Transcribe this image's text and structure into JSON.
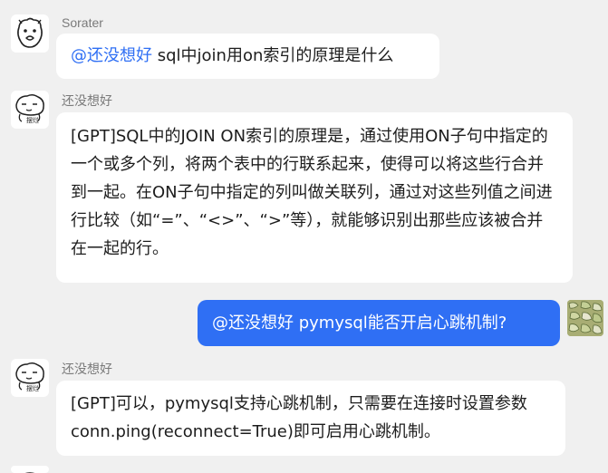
{
  "messages": [
    {
      "sender": "Sorater",
      "avatar_icon": "cartoon-face-icon",
      "mention": "@还没想好",
      "text": " sql中join用on索引的原理是什么"
    },
    {
      "sender": "还没想好",
      "avatar_icon": "cartoon-face-icon",
      "avatar_caption": "摆烂",
      "text": "[GPT]SQL中的JOIN ON索引的原理是，通过使用ON子句中指定的一个或多个列，将两个表中的行联系起来，使得可以将这些行合并到一起。在ON子句中指定的列叫做关联列，通过对这些列值之间进行比较（如“=”、“<>”、“>”等），就能够识别出那些应该被合并在一起的行。"
    },
    {
      "sender": "",
      "avatar_icon": "pattern-avatar-icon",
      "self": true,
      "text": "@还没想好 pymysql能否开启心跳机制?"
    },
    {
      "sender": "还没想好",
      "avatar_icon": "cartoon-face-icon",
      "avatar_caption": "摆烂",
      "text": "[GPT]可以，pymysql支持心跳机制，只需要在连接时设置参数conn.ping(reconnect=True)即可启用心跳机制。"
    }
  ],
  "colors": {
    "background": "#f0f0f0",
    "bubble": "#ffffff",
    "self_bubble": "#2f6ff4",
    "mention": "#2f6ff4",
    "sender": "#7a7a7a"
  }
}
